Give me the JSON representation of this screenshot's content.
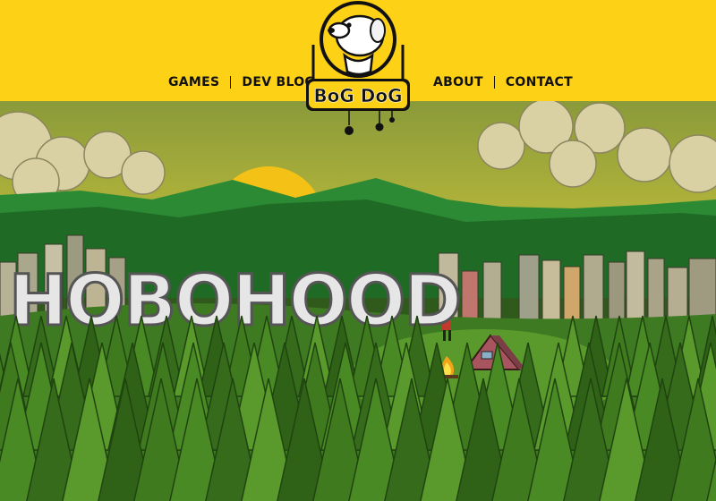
{
  "nav": {
    "left": [
      {
        "label": "GAMES"
      },
      {
        "label": "DEV BLOG"
      }
    ],
    "right": [
      {
        "label": "ABOUT"
      },
      {
        "label": "CONTACT"
      }
    ]
  },
  "logo": {
    "text": "BoG DoG"
  },
  "hero": {
    "title": "HOBOHOOD"
  },
  "colors": {
    "header": "#fdd116",
    "sky": "#a7b84a",
    "sun": "#f4c117",
    "hills": "#2e7a2a",
    "forest": "#3b6e22",
    "title_fill": "#e6e6e6"
  }
}
